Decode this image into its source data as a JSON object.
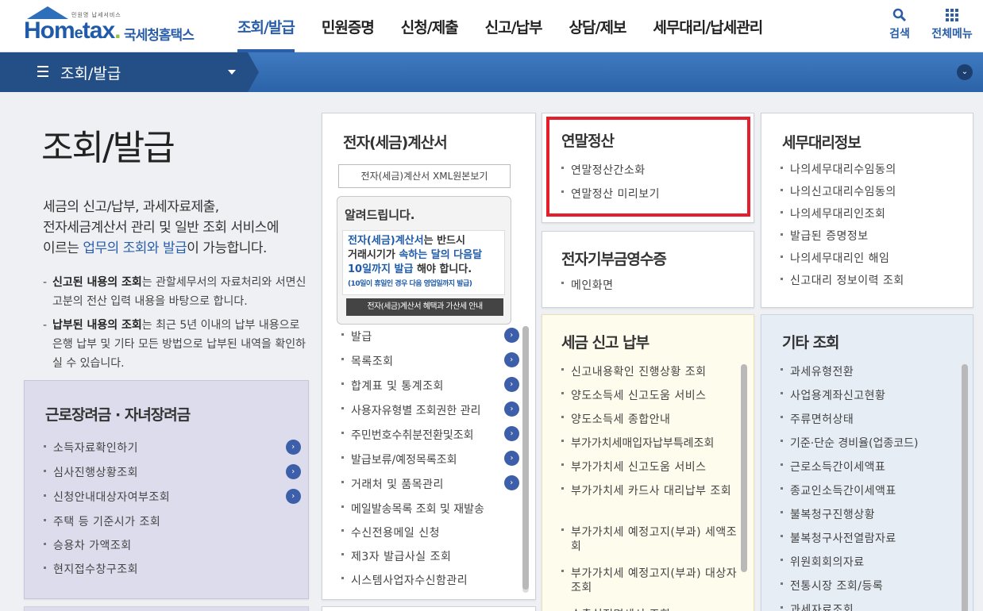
{
  "header": {
    "logo_tag": "민원명 납세서비스",
    "logo_word_1": "Hom",
    "logo_word_e": "e",
    "logo_word_2": "tax",
    "logo_kor": "국세청홈택스",
    "nav": [
      "조회/발급",
      "민원증명",
      "신청/제출",
      "신고/납부",
      "상담/제보",
      "세무대리/납세관리"
    ],
    "search_label": "검색",
    "menu_label": "전체메뉴"
  },
  "subbar": {
    "title": "조회/발급"
  },
  "intro": {
    "title": "조회/발급",
    "desc_1": "세금의 신고/납부, 과세자료제출,",
    "desc_2": "전자세금계산서 관리 및 일반 조회 서비스에",
    "desc_3a": "이르는 ",
    "desc_3b": "업무의 조회와 발급",
    "desc_3c": "이 가능합니다.",
    "note1_bold": "신고된 내용의 조회",
    "note1_rest": "는 관할세무서의 자료처리와 서면신고분의 전산 입력 내용을 바탕으로 합니다.",
    "note2_bold": "납부된 내용의 조회",
    "note2_rest": "는 최근 5년 이내의 납부 내용으로 은행 납부 및 기타 모든 방법으로 납부된 내역을 확인하실 수 있습니다."
  },
  "einvoice": {
    "title": "전자(세금)계산서",
    "xml_button": "전자(세금)계산서 XML원본보기",
    "notice_title": "알려드립니다.",
    "notice_l1a": "전자(세금)계산서",
    "notice_l1b": "는 반드시",
    "notice_l2a": "거래시기가 ",
    "notice_l2b": "속하는 달의 다음달",
    "notice_l3a": "10일까지 발급",
    "notice_l3b": " 해야 합니다.",
    "notice_small": "(10일이 휴일인 경우 다음 영업일까지 발급)",
    "notice_button": "전자(세금)계산서 혜택과 가산세 안내",
    "items": [
      "발급",
      "목록조회",
      "합계표 및 통계조회",
      "사용자유형별 조회권한 관리",
      "주민번호수취분전환및조회",
      "발급보류/예정목록조회",
      "거래처 및 품목관리",
      "메일발송목록 조회 및 재발송",
      "수신전용메일 신청",
      "제3자 발급사실 조회",
      "시스템사업자수신함관리"
    ]
  },
  "yearend": {
    "title": "연말정산",
    "items": [
      "연말정산간소화",
      "연말정산 미리보기"
    ]
  },
  "donation": {
    "title": "전자기부금영수증",
    "items": [
      "메인화면"
    ]
  },
  "tax_report": {
    "title": "세금 신고 납부",
    "items": [
      "신고내용확인 진행상황 조회",
      "양도소득세 신고도움 서비스",
      "양도소득세 종합안내",
      "부가가치세매입자납부특례조회",
      "부가가치세 신고도움 서비스",
      "부가가치세 카드사 대리납부 조회",
      "부가가치세 예정고지(부과) 세액조회",
      "부가가치세 예정고지(부과) 대상자 조회",
      "수출실적명세서 조회"
    ]
  },
  "agent_info": {
    "title": "세무대리정보",
    "items": [
      "나의세무대리수임동의",
      "나의신고대리수임동의",
      "나의세무대리인조회",
      "발급된 증명정보",
      "나의세무대리인 해임",
      "신고대리 정보이력 조회"
    ]
  },
  "other": {
    "title": "기타 조회",
    "items": [
      "과세유형전환",
      "사업용계좌신고현황",
      "주류면허상태",
      "기준·단순 경비율(업종코드)",
      "근로소득간이세액표",
      "종교인소득간이세액표",
      "불복청구진행상황",
      "불복청구사전열람자료",
      "위원회회의자료",
      "전통시장 조회/등록",
      "과세자료조회"
    ]
  },
  "eitc": {
    "title": "근로장려금 · 자녀장려금",
    "items": [
      "소득자료확인하기",
      "심사진행상황조회",
      "신청안내대상자여부조회",
      "주택 등 기준시가 조회",
      "승용차 가액조회",
      "현지접수창구조회"
    ]
  },
  "colors": {
    "brand": "#2a5ea8",
    "highlight_red": "#e41e2a",
    "cream_card": "#fefcec",
    "lilac_card": "#dcdcec",
    "blue_card": "#e6edf5"
  }
}
